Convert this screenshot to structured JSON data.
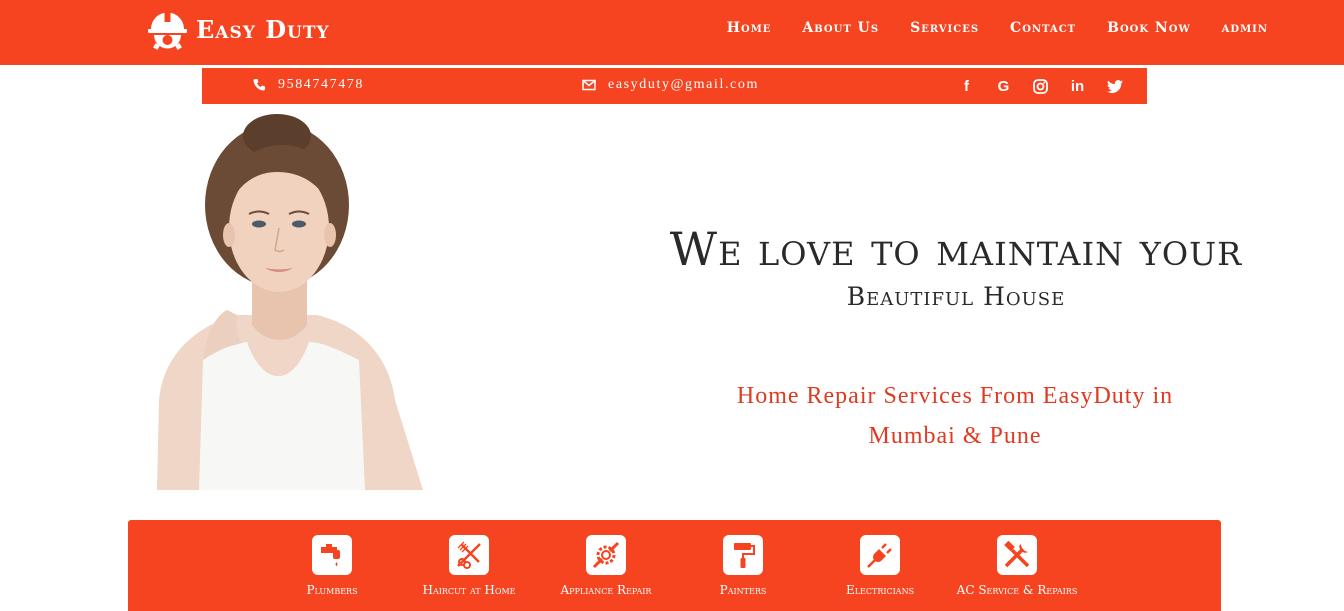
{
  "brand": {
    "name": "Easy Duty",
    "icon": "helmet-gear-icon"
  },
  "nav": {
    "items": [
      {
        "label": "Home"
      },
      {
        "label": "About Us"
      },
      {
        "label": "Services"
      },
      {
        "label": "Contact"
      },
      {
        "label": "Book Now"
      },
      {
        "label": "admin"
      }
    ]
  },
  "contact": {
    "phone": "9584747478",
    "phone_icon": "phone-icon",
    "email": "easyduty@gmail.com",
    "email_icon": "envelope-icon"
  },
  "social": {
    "facebook": "f",
    "google": "G",
    "instagram_icon": "instagram-icon",
    "linkedin": "in",
    "twitter_icon": "twitter-icon"
  },
  "hero": {
    "title": "We love to maintain your",
    "subtitle": "Beautiful House",
    "tagline": "Home Repair Services From EasyDuty in Mumbai & Pune"
  },
  "services": [
    {
      "label": "Plumbers",
      "icon": "faucet-icon"
    },
    {
      "label": "Haircut at Home",
      "icon": "scissors-comb-icon"
    },
    {
      "label": "Appliance Repair",
      "icon": "gear-wrench-icon"
    },
    {
      "label": "Painters",
      "icon": "paint-roller-icon"
    },
    {
      "label": "Electricians",
      "icon": "plug-icon"
    },
    {
      "label": "AC Service & Repairs",
      "icon": "tools-icon"
    }
  ],
  "colors": {
    "primary": "#f64420",
    "accent_text": "#e03a22",
    "heading": "#2a2a2a"
  }
}
